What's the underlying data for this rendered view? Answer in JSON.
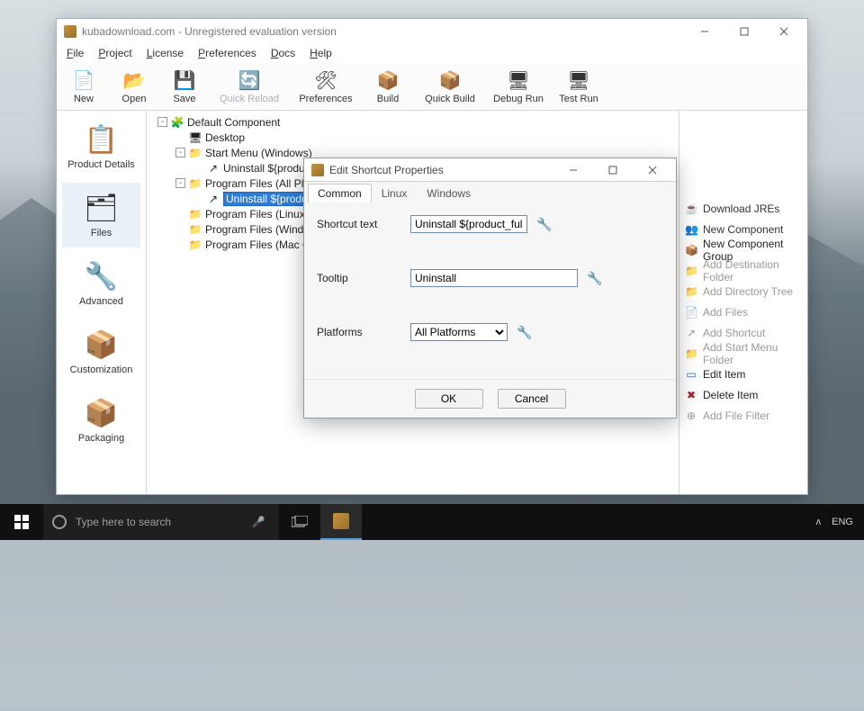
{
  "window": {
    "title": "kubadownload.com - Unregistered evaluation version"
  },
  "menu": [
    "File",
    "Project",
    "License",
    "Preferences",
    "Docs",
    "Help"
  ],
  "toolbar": [
    {
      "label": "New",
      "icon": "new"
    },
    {
      "label": "Open",
      "icon": "open"
    },
    {
      "label": "Save",
      "icon": "save"
    },
    {
      "label": "Quick Reload",
      "icon": "reload",
      "disabled": true
    },
    {
      "label": "Preferences",
      "icon": "prefs"
    },
    {
      "label": "Build",
      "icon": "build"
    },
    {
      "label": "Quick Build",
      "icon": "qbuild"
    },
    {
      "label": "Debug Run",
      "icon": "drun"
    },
    {
      "label": "Test Run",
      "icon": "trun"
    }
  ],
  "leftnav": [
    {
      "label": "Product Details",
      "icon": "clipboard"
    },
    {
      "label": "Files",
      "icon": "files",
      "selected": true
    },
    {
      "label": "Advanced",
      "icon": "wrench"
    },
    {
      "label": "Customization",
      "icon": "box-wrench"
    },
    {
      "label": "Packaging",
      "icon": "box"
    }
  ],
  "tree": [
    {
      "depth": 0,
      "twisty": "-",
      "icon": "component",
      "label": "Default Component"
    },
    {
      "depth": 1,
      "twisty": "",
      "icon": "desktop",
      "label": "Desktop"
    },
    {
      "depth": 1,
      "twisty": "-",
      "icon": "folder",
      "label": "Start Menu (Windows)"
    },
    {
      "depth": 2,
      "twisty": "",
      "icon": "shortcut",
      "label": "Uninstall ${product_fullname}"
    },
    {
      "depth": 1,
      "twisty": "-",
      "icon": "folder",
      "label": "Program Files (All Platforms)"
    },
    {
      "depth": 2,
      "twisty": "",
      "icon": "shortcut",
      "label": "Uninstall ${product_fullname}",
      "selected": true
    },
    {
      "depth": 1,
      "twisty": "",
      "icon": "folder",
      "label": "Program Files (Linux)"
    },
    {
      "depth": 1,
      "twisty": "",
      "icon": "folder",
      "label": "Program Files (Windows)"
    },
    {
      "depth": 1,
      "twisty": "",
      "icon": "folder",
      "label": "Program Files (Mac OS X)"
    }
  ],
  "rightpane": [
    {
      "label": "Download JREs",
      "icon": "☕"
    },
    {
      "label": "New Component",
      "icon": "👥"
    },
    {
      "label": "New Component Group",
      "icon": "📦",
      "color": "#2a6db9"
    },
    {
      "label": "Add Destination Folder",
      "icon": "📁",
      "muted": true
    },
    {
      "label": "Add Directory Tree",
      "icon": "📁",
      "muted": true
    },
    {
      "label": "Add Files",
      "icon": "📄",
      "muted": true
    },
    {
      "label": "Add Shortcut",
      "icon": "↗",
      "muted": true
    },
    {
      "label": "Add Start Menu Folder",
      "icon": "📁",
      "muted": true
    },
    {
      "label": "Edit Item",
      "icon": "▭",
      "color": "#2a6db9"
    },
    {
      "label": "Delete Item",
      "icon": "✖",
      "color": "#aa2222"
    },
    {
      "label": "Add File Filter",
      "icon": "⊕",
      "muted": true
    }
  ],
  "dialog": {
    "title": "Edit Shortcut Properties",
    "tabs": [
      "Common",
      "Linux",
      "Windows"
    ],
    "active_tab": 0,
    "fields": {
      "shortcut_label": "Shortcut text",
      "shortcut_value": "Uninstall ${product_ful",
      "tooltip_label": "Tooltip",
      "tooltip_value": "Uninstall",
      "platforms_label": "Platforms",
      "platforms_value": "All Platforms"
    },
    "buttons": {
      "ok": "OK",
      "cancel": "Cancel"
    }
  },
  "taskbar": {
    "search_placeholder": "Type here to search",
    "lang": "ENG"
  }
}
